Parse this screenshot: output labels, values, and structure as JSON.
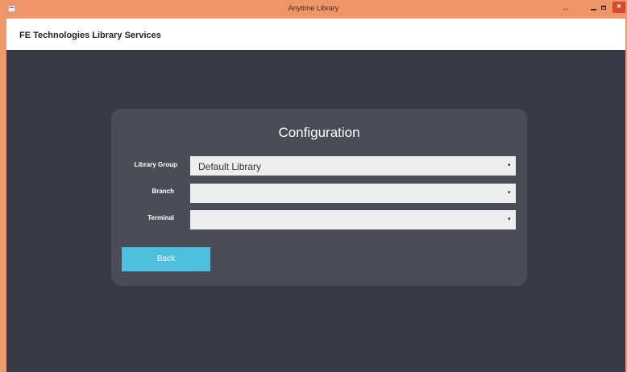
{
  "window": {
    "title": "Anytime Library",
    "extra_icon_glyph": "↔",
    "close_glyph": "×"
  },
  "header": {
    "title": "FE Technologies Library Services"
  },
  "configuration": {
    "title": "Configuration",
    "fields": [
      {
        "label": "Library Group",
        "value": "Default Library"
      },
      {
        "label": "Branch",
        "value": ""
      },
      {
        "label": "Terminal",
        "value": ""
      }
    ],
    "dropdown_arrow": "▾",
    "back_label": "Back"
  },
  "colors": {
    "titlebar": "#ef9668",
    "background": "#363a44",
    "panel": "#4a4d58",
    "button": "#4fbfe0"
  }
}
